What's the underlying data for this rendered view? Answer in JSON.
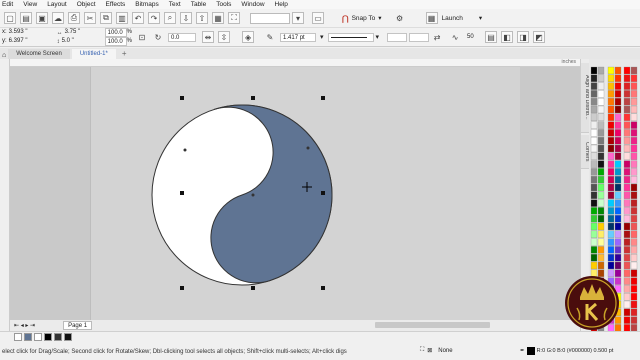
{
  "menu": [
    "Edit",
    "View",
    "Layout",
    "Object",
    "Effects",
    "Bitmaps",
    "Text",
    "Table",
    "Tools",
    "Window",
    "Help"
  ],
  "toolbar": {
    "snap_label": "Snap To",
    "launch_label": "Launch"
  },
  "props": {
    "x": "3.593 \"",
    "y": "6.397 \"",
    "w": "3.75 \"",
    "h": "5.0 \"",
    "sx": "100.0",
    "sy": "100.0",
    "pct": "%",
    "angle": "0.0",
    "outline_width": "1.417 pt",
    "smooth": "50"
  },
  "tabs": {
    "welcome": "Welcome Screen",
    "doc": "Untitled-1*"
  },
  "ruler_units": "inches",
  "docker_tabs": [
    "Align and Distrib...",
    "Corners"
  ],
  "page_tab": "Page 1",
  "status": {
    "hint": "elect click for Drag/Scale; Second click for Rotate/Skew; Dbl-clicking tool selects all objects; Shift+click multi-selects; Alt+click digs",
    "fill_label": "None",
    "outline_label": "R:0 G:0 B:0 (#000000)  0.500 pt"
  },
  "colors": {
    "shape_fill": "#5f7493",
    "canvas": "#c9c9c9"
  }
}
